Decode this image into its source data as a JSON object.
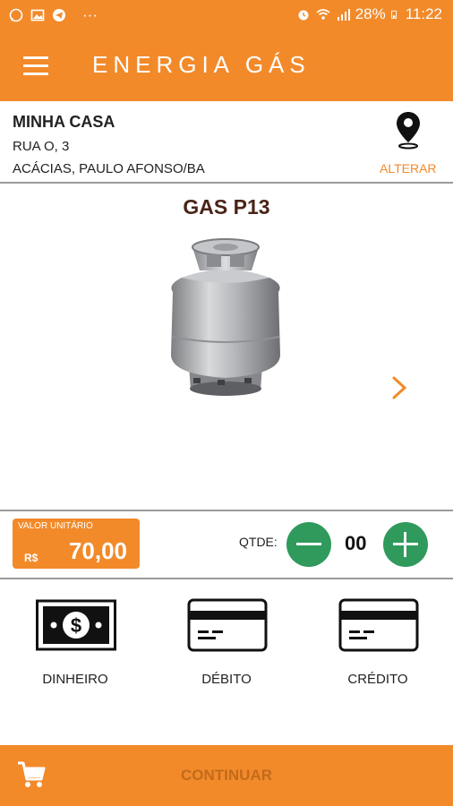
{
  "statusbar": {
    "battery": "28%",
    "time": "11:22",
    "more": "···",
    "icons": [
      "whatsapp-icon",
      "gallery-icon",
      "telegram-icon",
      "alarm-icon",
      "wifi-icon",
      "signal-icon",
      "battery-icon"
    ]
  },
  "appbar": {
    "title": "ENERGIA GÁS"
  },
  "address": {
    "name": "MINHA CASA",
    "street": "RUA O, 3",
    "city": "ACÁCIAS, PAULO AFONSO/BA",
    "change_label": "ALTERAR"
  },
  "product": {
    "name": "GAS P13"
  },
  "price": {
    "label": "VALOR UNITÁRIO",
    "currency": "R$",
    "value": "70,00"
  },
  "quantity": {
    "label": "QTDE:",
    "value": "00"
  },
  "payment": {
    "options": [
      {
        "label": "DINHEIRO",
        "icon": "cash-icon"
      },
      {
        "label": "DÉBITO",
        "icon": "card-icon"
      },
      {
        "label": "CRÉDITO",
        "icon": "card-icon"
      }
    ]
  },
  "footer": {
    "continue_label": "CONTINUAR"
  },
  "colors": {
    "accent": "#f28a2a",
    "green": "#2f9a5c",
    "product_title": "#4a2418"
  }
}
